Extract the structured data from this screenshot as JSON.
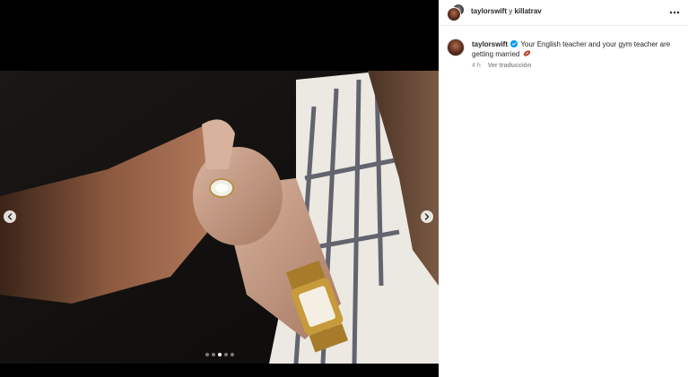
{
  "post": {
    "header": {
      "user_primary": "taylorswift",
      "separator": " y ",
      "user_secondary": "killatrav"
    },
    "caption": {
      "username": "taylorswift",
      "text": "Your English teacher and your gym teacher are getting married",
      "emoji_icon": "football-emoji-icon",
      "time": "4 h",
      "translate_label": "Ver traducción"
    },
    "carousel": {
      "total_slides": 5,
      "current_slide": 3
    }
  },
  "colors": {
    "media_background": "#000000",
    "verified_badge": "#0095f6",
    "muted_text": "#8e8e8e"
  }
}
